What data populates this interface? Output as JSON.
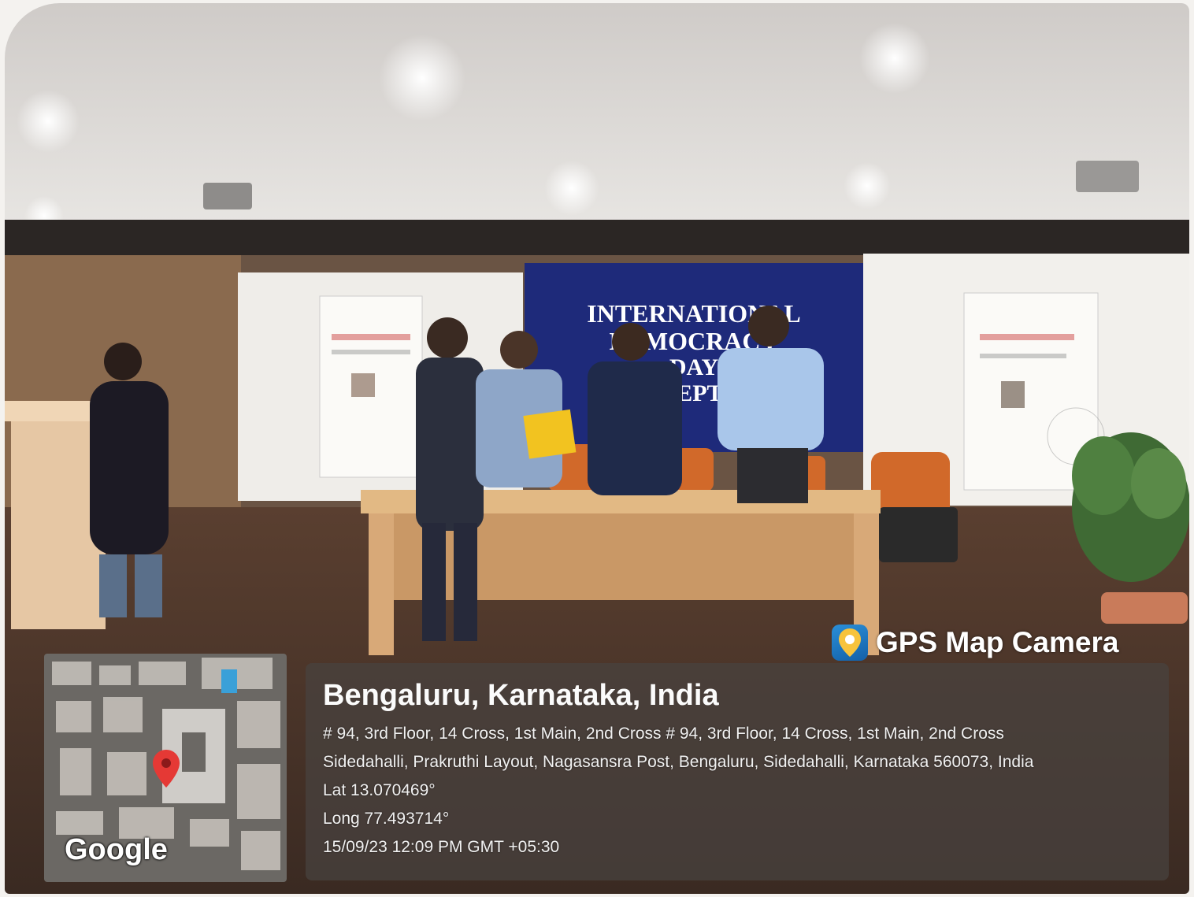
{
  "badge": {
    "app_name": "GPS Map Camera",
    "icon": "map-pin-icon"
  },
  "location": {
    "title": "Bengaluru, Karnataka, India",
    "address_line_1": "# 94, 3rd Floor, 14 Cross, 1st Main, 2nd Cross # 94, 3rd Floor, 14 Cross, 1st Main, 2nd Cross",
    "address_line_2": "Sidedahalli, Prakruthi Layout, Nagasansra Post, Bengaluru, Sidedahalli, Karnataka 560073, India",
    "latitude": "Lat 13.070469°",
    "longitude": "Long 77.493714°",
    "timestamp": "15/09/23 12:09 PM GMT +05:30"
  },
  "map": {
    "logo_text": "Google",
    "marker_icon": "map-marker-icon"
  },
  "scene": {
    "screen_text": [
      "INTERNATIONAL",
      "DEMOCRACY",
      "DAY",
      "SEPT 2"
    ],
    "screen_color": "#1e2a7a",
    "backdrop_color": "#f0eeea",
    "panel_color": "#484240"
  }
}
